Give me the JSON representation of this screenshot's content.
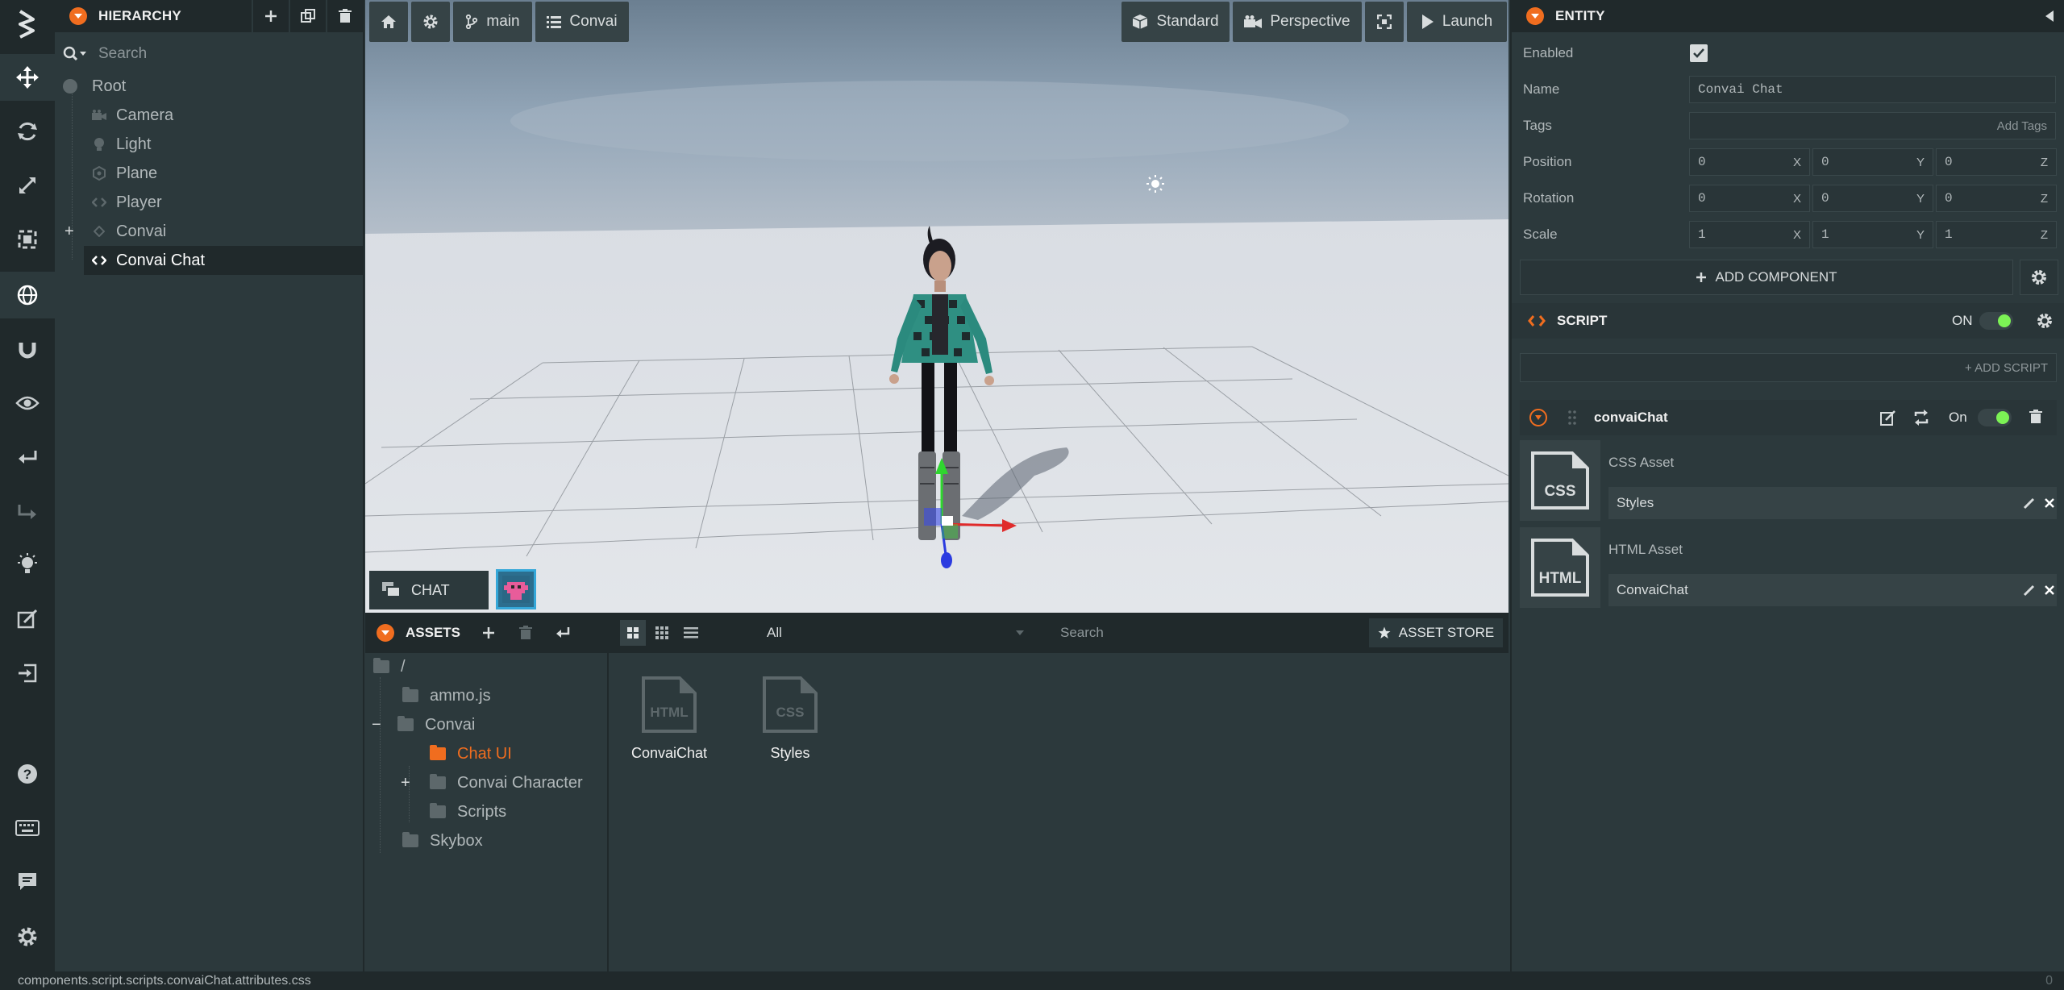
{
  "hierarchy": {
    "title": "HIERARCHY",
    "search_placeholder": "Search",
    "items": [
      {
        "label": "Root"
      },
      {
        "label": "Camera"
      },
      {
        "label": "Light"
      },
      {
        "label": "Plane"
      },
      {
        "label": "Player"
      },
      {
        "label": "Convai"
      },
      {
        "label": "Convai Chat"
      }
    ]
  },
  "viewport": {
    "home_label": "",
    "branch_label": "main",
    "scene_label": "Convai",
    "render_mode": "Standard",
    "camera_mode": "Perspective",
    "launch_label": "Launch",
    "chat_label": "CHAT"
  },
  "assets": {
    "title": "ASSETS",
    "filter_value": "All",
    "search_placeholder": "Search",
    "store_label": "ASSET STORE",
    "tree": [
      {
        "label": "/"
      },
      {
        "label": "ammo.js"
      },
      {
        "label": "Convai"
      },
      {
        "label": "Chat UI"
      },
      {
        "label": "Convai Character"
      },
      {
        "label": "Scripts"
      },
      {
        "label": "Skybox"
      }
    ],
    "files": [
      {
        "name": "ConvaiChat",
        "type": "HTML"
      },
      {
        "name": "Styles",
        "type": "CSS"
      }
    ]
  },
  "inspector": {
    "title": "ENTITY",
    "enabled_label": "Enabled",
    "name_label": "Name",
    "name_value": "Convai Chat",
    "tags_label": "Tags",
    "add_tags_label": "Add Tags",
    "position_label": "Position",
    "rotation_label": "Rotation",
    "scale_label": "Scale",
    "position": [
      "0",
      "0",
      "0"
    ],
    "rotation": [
      "0",
      "0",
      "0"
    ],
    "scale": [
      "1",
      "1",
      "1"
    ],
    "axes": [
      "X",
      "Y",
      "Z"
    ],
    "add_component_label": "ADD COMPONENT",
    "script": {
      "title": "SCRIPT",
      "on_label": "ON",
      "add_script_label": "+ ADD SCRIPT",
      "instance_name": "convaiChat",
      "instance_on_label": "On",
      "css_asset_label": "CSS Asset",
      "css_asset_value": "Styles",
      "css_badge": "CSS",
      "html_asset_label": "HTML Asset",
      "html_asset_value": "ConvaiChat",
      "html_badge": "HTML"
    }
  },
  "status": {
    "path": "components.script.scripts.convaiChat.attributes.css",
    "right_value": "0"
  },
  "colors": {
    "accent": "#f06d1f",
    "toggle_on": "#7cf255",
    "panel_dark": "#20292b",
    "panel": "#2c393c"
  }
}
